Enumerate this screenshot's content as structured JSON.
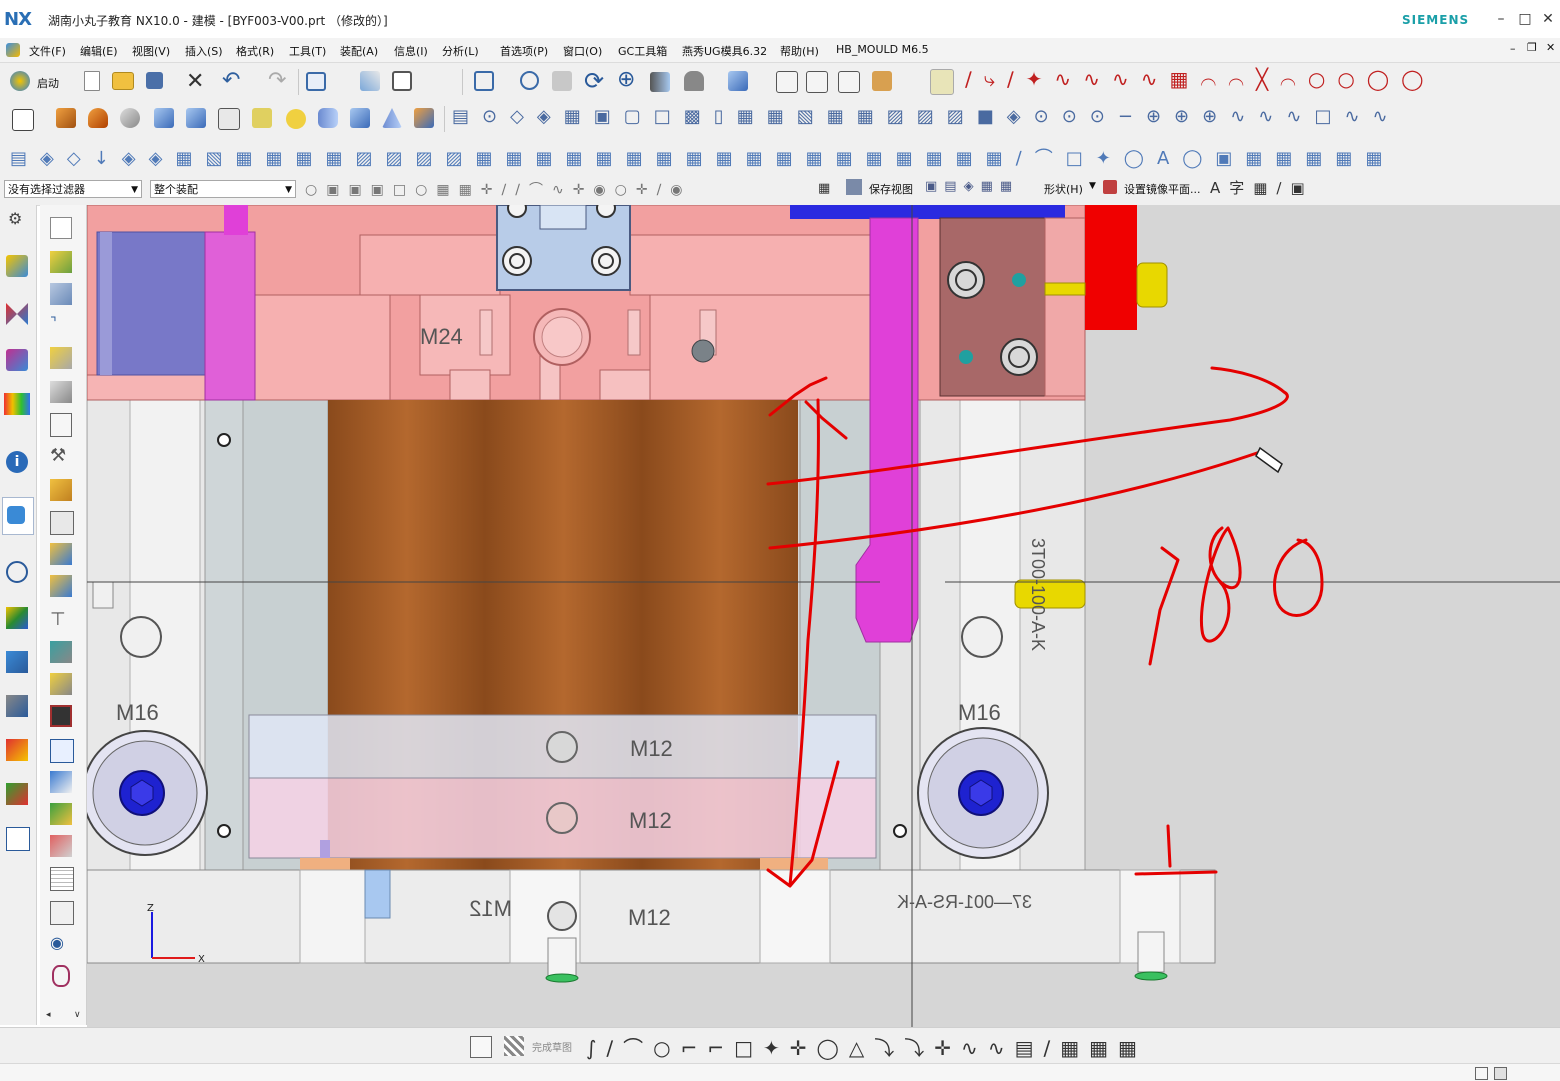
{
  "app": {
    "logo": "NX",
    "title": "湖南小丸子教育 NX10.0 - 建模 - [BYF003-V00.prt （修改的）]",
    "brand": "SIEMENS",
    "window_controls": [
      "minimize-icon",
      "restore-icon",
      "close-icon"
    ]
  },
  "menubar": {
    "items": [
      "文件(F)",
      "编辑(E)",
      "视图(V)",
      "插入(S)",
      "格式(R)",
      "工具(T)",
      "装配(A)",
      "信息(I)",
      "分析(L)",
      "首选项(P)",
      "窗口(O)",
      "GC工具箱",
      "燕秀UG模具6.32",
      "帮助(H)",
      "HB_MOULD M6.5"
    ]
  },
  "toolbar": {
    "start_label": "启动"
  },
  "selection_bar": {
    "filter_value": "没有选择过滤器",
    "scope_value": "整个装配",
    "save_view": "保存视图",
    "shape": "形状(H)",
    "mirror_plane": "设置镜像平面..."
  },
  "sketch_toolbar": {
    "finish_sketch": "完成草图"
  },
  "viewport": {
    "labels": {
      "m24": "M24",
      "m16_left": "M16",
      "m16_right": "M16",
      "m12_upper": "M12",
      "m12_lower": "M12",
      "m12_base_mirror": "M12",
      "m12_base": "M12",
      "part_code_vertical": "3T00-100-A-K",
      "part_code_mirrored": "37—001-RS-A-K"
    },
    "annotation": "180",
    "axis": {
      "z": "Z",
      "x": "X"
    },
    "colors": {
      "plate_pink": "#f2a0a0",
      "copper": "#a05a28",
      "magenta": "#e040d8",
      "blue": "#2a2ae0",
      "red": "#f00000",
      "yellow": "#e8d800",
      "ink": "#e40000"
    }
  }
}
